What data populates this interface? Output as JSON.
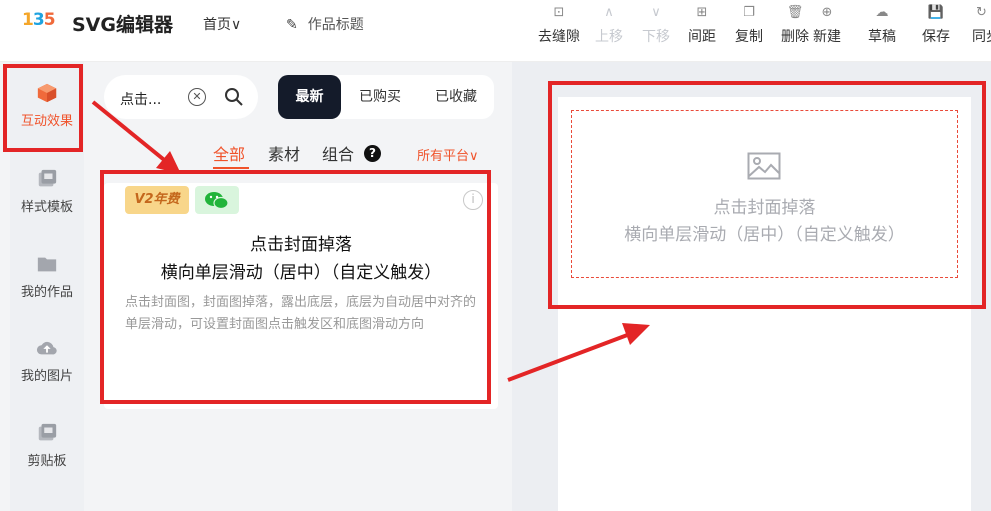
{
  "app": {
    "logo_letters": [
      "1",
      "3",
      "5"
    ],
    "title": "SVG编辑器",
    "home": "首页",
    "work_title": "作品标题"
  },
  "toolbar": [
    {
      "icon": "remove-gap-icon",
      "label": "去缝隙",
      "enabled": true
    },
    {
      "icon": "chevron-up-icon",
      "label": "上移",
      "enabled": false
    },
    {
      "icon": "chevron-down-icon",
      "label": "下移",
      "enabled": false
    },
    {
      "icon": "spacing-icon",
      "label": "间距",
      "enabled": true
    },
    {
      "icon": "copy-icon",
      "label": "复制",
      "enabled": true
    },
    {
      "icon": "trash-icon",
      "label": "删除",
      "enabled": true
    },
    {
      "icon": "new-file-icon",
      "label": "新建",
      "enabled": true
    },
    {
      "icon": "cloud-icon",
      "label": "草稿",
      "enabled": true
    },
    {
      "icon": "save-icon",
      "label": "保存",
      "enabled": true
    },
    {
      "icon": "sync-icon",
      "label": "同步",
      "enabled": true
    }
  ],
  "sidebar": [
    {
      "icon": "cube-icon",
      "label": "互动效果",
      "active": true
    },
    {
      "icon": "template-icon",
      "label": "样式模板",
      "active": false
    },
    {
      "icon": "folder-icon",
      "label": "我的作品",
      "active": false
    },
    {
      "icon": "cloud-upload-icon",
      "label": "我的图片",
      "active": false
    },
    {
      "icon": "clipboard-icon",
      "label": "剪贴板",
      "active": false
    }
  ],
  "search": {
    "value": "点击..."
  },
  "sort_tabs": [
    {
      "label": "最新",
      "active": true
    },
    {
      "label": "已购买",
      "active": false
    },
    {
      "label": "已收藏",
      "active": false
    }
  ],
  "filters": [
    {
      "label": "全部",
      "active": true
    },
    {
      "label": "素材",
      "active": false
    },
    {
      "label": "组合",
      "active": false
    }
  ],
  "platform": "所有平台",
  "card": {
    "badge": "V2年费",
    "title_line1": "点击封面掉落",
    "title_line2": "横向单层滑动（居中）（自定义触发）",
    "description": "点击封面图，封面图掉落，露出底层，底层为自动居中对齐的单层滑动，可设置封面图点击触发区和底图滑动方向"
  },
  "preview": {
    "line1": "点击封面掉落",
    "line2": "横向单层滑动（居中）（自定义触发）"
  },
  "colors": {
    "accent": "#f0532b",
    "highlight": "#e32526",
    "dark": "#141b2a"
  }
}
